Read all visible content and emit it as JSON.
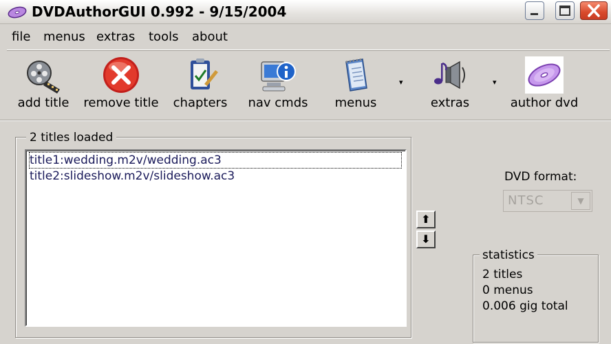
{
  "window": {
    "title": "DVDAuthorGUI 0.992 - 9/15/2004",
    "icons": [
      "disc-icon",
      "minimize-icon",
      "maximize-icon",
      "close-icon"
    ]
  },
  "menubar": {
    "items": [
      "file",
      "menus",
      "extras",
      "tools",
      "about"
    ]
  },
  "toolbar": {
    "buttons": [
      {
        "label": "add title",
        "icon": "film-reel-icon"
      },
      {
        "label": "remove title",
        "icon": "red-x-icon"
      },
      {
        "label": "chapters",
        "icon": "clipboard-check-icon"
      },
      {
        "label": "nav cmds",
        "icon": "computer-info-icon"
      },
      {
        "label": "menus",
        "icon": "notepad-icon"
      },
      {
        "label": "extras",
        "icon": "music-speaker-icon"
      },
      {
        "label": "author dvd",
        "icon": "dvd-disc-icon"
      }
    ],
    "dropdown_arrow": "▾"
  },
  "titles_group": {
    "legend": "2 titles loaded",
    "items": [
      "title1:wedding.m2v/wedding.ac3",
      "title2:slideshow.m2v/slideshow.ac3"
    ],
    "selected_index": 0
  },
  "order_buttons": {
    "up": "⬆",
    "down": "⬇"
  },
  "dvd_format": {
    "label": "DVD format:",
    "value": "NTSC",
    "enabled": false
  },
  "statistics": {
    "legend": "statistics",
    "lines": [
      "2 titles",
      "0 menus",
      "0.006 gig total"
    ]
  },
  "colors": {
    "window_bg": "#d6d3ce",
    "close_button": "#d84a2c",
    "list_text": "#1a1a5a",
    "disabled_text": "#a6a39e"
  }
}
